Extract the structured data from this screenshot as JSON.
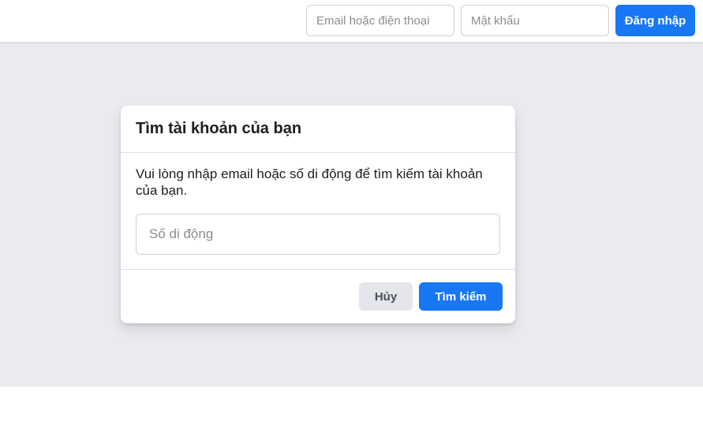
{
  "header": {
    "email_placeholder": "Email hoặc điện thoại",
    "password_placeholder": "Mật khẩu",
    "login_label": "Đăng nhập"
  },
  "dialog": {
    "title": "Tìm tài khoản của bạn",
    "description": "Vui lòng nhập email hoặc số di động để tìm kiếm tài khoản của bạn.",
    "phone_placeholder": "Số di động",
    "phone_value": "",
    "cancel_label": "Hủy",
    "search_label": "Tìm kiếm"
  },
  "colors": {
    "primary": "#1877f2",
    "background_gray": "#e9ebee",
    "cancel_button": "#e4e6eb"
  }
}
